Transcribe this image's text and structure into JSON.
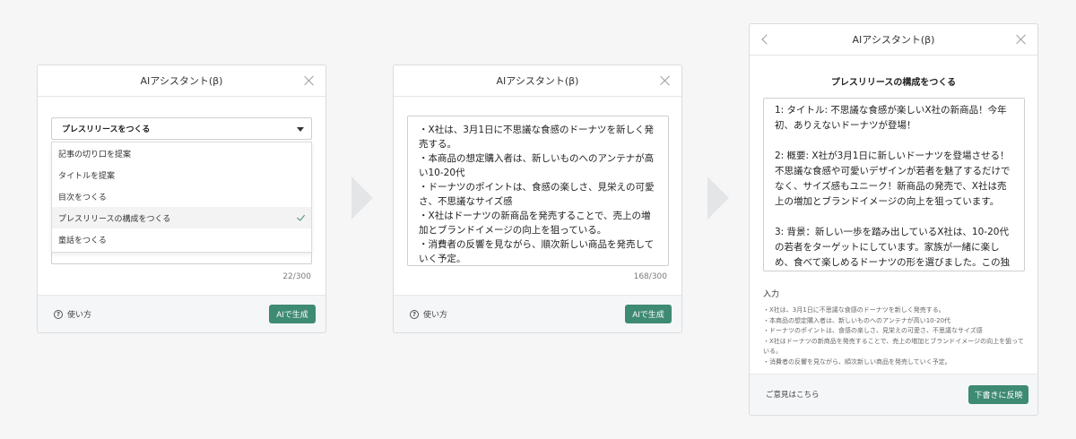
{
  "assistant_title": "AIアシスタント(β)",
  "panel1": {
    "selected_option": "プレスリリースをつくる",
    "options": [
      "記事の切り口を提案",
      "タイトルを提案",
      "目次をつくる",
      "プレスリリースの構成をつくる",
      "童話をつくる"
    ],
    "selected_index": 3,
    "counter": "22/300",
    "help_label": "使い方",
    "generate_label": "AIで生成"
  },
  "panel2": {
    "text": "・X社は、3月1日に不思議な食感のドーナツを新しく発売する。\n・本商品の想定購入者は、新しいものへのアンテナが高い10-20代\n・ドーナツのポイントは、食感の楽しさ、見栄えの可愛さ、不思議なサイズ感\n・X社はドーナツの新商品を発売することで、売上の増加とブランドイメージの向上を狙っている。\n・消費者の反響を見ながら、順次新しい商品を発売していく予定。",
    "counter": "168/300",
    "help_label": "使い方",
    "generate_label": "AIで生成"
  },
  "panel3": {
    "subtitle": "プレスリリースの構成をつくる",
    "output_text": "1: タイトル: 不思議な食感が楽しいX社の新商品！今年初、ありえないドーナツが登場！\n\n2: 概要: X社が3月1日に新しいドーナツを登場させる！不思議な食感や可愛いデザインが若者を魅了するだけでなく、サイズ感もユニーク！新商品の発売で、X社は売上の増加とブランドイメージの向上を狙っています。\n\n3: 背景：新しい一歩を踏み出しているX社は、10-20代の若者をターゲットにしています。家族が一緒に楽しめ、食べて楽しめるドーナツの形を選びました。この独創的なドーナツを通して、新鮮で創造的な経験を提供し",
    "input_label": "入力",
    "input_lines": [
      "・X社は、3月1日に不思議な食感のドーナツを新しく発売する。",
      "・本商品の想定購入者は、新しいものへのアンテナが高い10-20代",
      "・ドーナツのポイントは、食感の楽しさ、見栄えの可愛さ、不思議なサイズ感",
      "・X社はドーナツの新商品を発売することで、売上の増加とブランドイメージの向上を狙っている。",
      "・消費者の反響を見ながら、順次新しい商品を発売していく予定。"
    ],
    "feedback_label": "ご意見はこちら",
    "apply_label": "下書きに反映"
  },
  "colors": {
    "accent": "#3e8a73",
    "background": "#f6f6f6",
    "arrow": "#e3e5e7"
  }
}
